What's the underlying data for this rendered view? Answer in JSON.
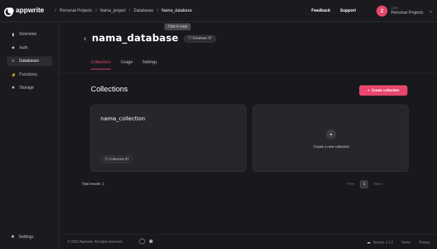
{
  "header": {
    "logo_text": "appwrite",
    "breadcrumb": [
      "Personal Projects",
      "Nama_project",
      "Databases",
      "Nama_database"
    ],
    "separator": "/",
    "feedback_label": "Feedback",
    "support_label": "Support",
    "avatar_initial": "Z",
    "user_label": "Zaid",
    "org_name": "Personal Projects",
    "accent_color": "#e8466e"
  },
  "sidebar": {
    "items": [
      {
        "label": "Overview",
        "icon": "chart-bars-icon",
        "glyph": "▮"
      },
      {
        "label": "Auth",
        "icon": "users-icon",
        "glyph": "☻"
      },
      {
        "label": "Databases",
        "icon": "database-icon",
        "glyph": "≡"
      },
      {
        "label": "Functions",
        "icon": "lightning-icon",
        "glyph": "⚡"
      },
      {
        "label": "Storage",
        "icon": "folder-icon",
        "glyph": "■"
      }
    ],
    "active": "Databases",
    "settings_label": "Settings"
  },
  "main": {
    "tooltip": "Click to copy",
    "back_glyph": "‹",
    "database_name": "nama_database",
    "database_id_label": "Database ID",
    "tabs": [
      {
        "label": "Collections",
        "active": true
      },
      {
        "label": "Usage",
        "active": false
      },
      {
        "label": "Settings",
        "active": false
      }
    ],
    "section_title": "Collections",
    "create_button": "Create collection",
    "collection_card": {
      "name": "nama_collection",
      "id_label": "Collection ID"
    },
    "new_card": {
      "plus": "+",
      "label": "Create a new collection"
    },
    "total_results": "Total results: 1",
    "pagination": {
      "prev": "Prev",
      "page": "1",
      "next": "Next"
    }
  },
  "footer": {
    "copyright": "© 2023 Appwrite. All rights reserved.",
    "version": "Version 1.1.2",
    "terms": "Terms",
    "privacy": "Privacy"
  }
}
